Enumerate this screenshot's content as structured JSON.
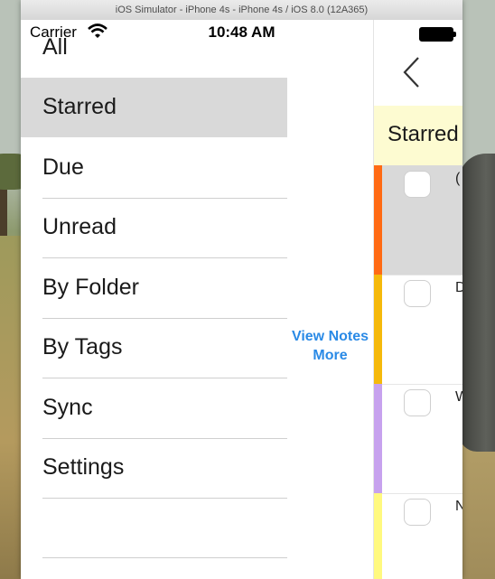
{
  "window": {
    "title": "iOS Simulator - iPhone 4s - iPhone 4s / iOS 8.0 (12A365)"
  },
  "status_bar": {
    "carrier": "Carrier",
    "time": "10:48 AM"
  },
  "menu": {
    "items": [
      {
        "label": "All",
        "selected": false
      },
      {
        "label": "Starred",
        "selected": true
      },
      {
        "label": "Due",
        "selected": false
      },
      {
        "label": "Unread",
        "selected": false
      },
      {
        "label": "By Folder",
        "selected": false
      },
      {
        "label": "By Tags",
        "selected": false
      },
      {
        "label": "Sync",
        "selected": false
      },
      {
        "label": "Settings",
        "selected": false
      }
    ]
  },
  "actions": {
    "view_notes_line1": "View Notes",
    "view_notes_line2": "More"
  },
  "list": {
    "header": "Starred",
    "notes": [
      {
        "color": "#ff6a13",
        "preview": "("
      },
      {
        "color": "#f5b90b",
        "preview": "D"
      },
      {
        "color": "#c7a2ee",
        "preview": "W"
      },
      {
        "color": "#fff97f",
        "preview": "N"
      }
    ]
  }
}
